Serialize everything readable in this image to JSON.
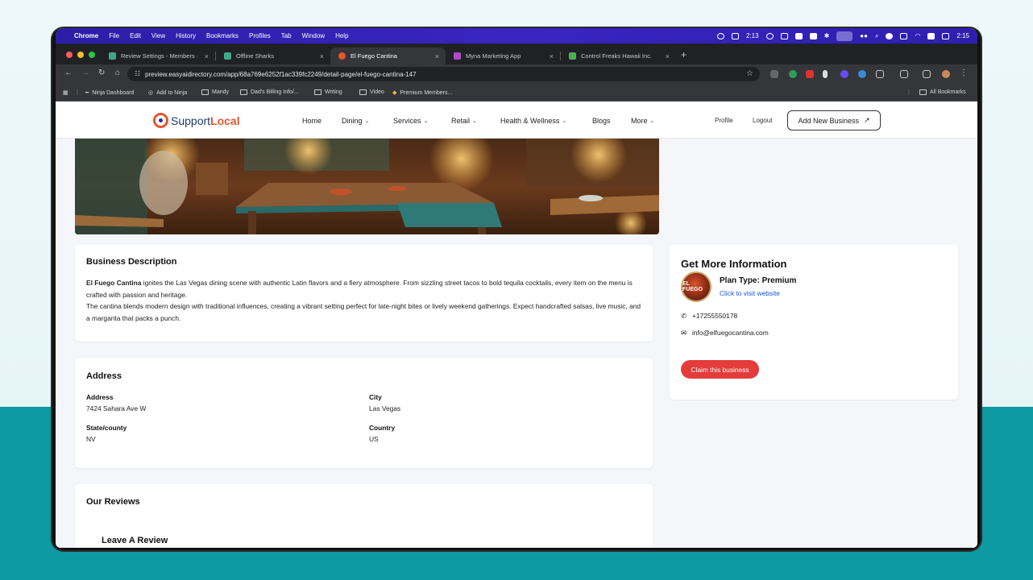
{
  "menubar": {
    "app": "Chrome",
    "items": [
      "File",
      "Edit",
      "View",
      "History",
      "Bookmarks",
      "Profiles",
      "Tab",
      "Window",
      "Help"
    ],
    "status_time_left": "2:13",
    "clock": "2:15"
  },
  "tabs": [
    {
      "label": "Review Settings - Members ·",
      "active": false
    },
    {
      "label": "Offline Sharks",
      "active": false
    },
    {
      "label": "El Fuego Cantina",
      "active": true
    },
    {
      "label": "Myna Marketing App",
      "active": false
    },
    {
      "label": "Control Freaks Hawaii Inc.",
      "active": false
    }
  ],
  "address_bar": {
    "url": "preview.easyaidirectory.com/app/68a769e6252f1ac339fc2249/detail-page/el-fuego-cantina-147"
  },
  "bookmarks": [
    {
      "label": "Ninja Dashboard"
    },
    {
      "label": "Add to Ninja"
    },
    {
      "label": "Mandy"
    },
    {
      "label": "Dad's Billing Info/..."
    },
    {
      "label": "Writing"
    },
    {
      "label": "Video"
    },
    {
      "label": "Premium Members..."
    }
  ],
  "all_bookmarks": "All Bookmarks",
  "site": {
    "logo_part1": "Support",
    "logo_part2": "Local",
    "nav": [
      {
        "label": "Home",
        "dropdown": false
      },
      {
        "label": "Dining",
        "dropdown": true
      },
      {
        "label": "Services",
        "dropdown": true
      },
      {
        "label": "Retail",
        "dropdown": true
      },
      {
        "label": "Health & Wellness",
        "dropdown": true
      },
      {
        "label": "Blogs",
        "dropdown": false
      },
      {
        "label": "More",
        "dropdown": true
      }
    ],
    "profile": "Profile",
    "logout": "Logout",
    "add_business": "Add New Business",
    "add_business_icon": "↗"
  },
  "description": {
    "heading": "Business Description",
    "business_name": "El Fuego Cantina",
    "para1_rest": " ignites the Las Vegas dining scene with authentic Latin flavors and a fiery atmosphere. From sizzling street tacos to bold tequila cocktails, every item on the menu is crafted with passion and heritage.",
    "para2": "The cantina blends modern design with traditional influences, creating a vibrant setting perfect for late-night bites or lively weekend gatherings. Expect handcrafted salsas, live music, and a margarita that packs a punch."
  },
  "address": {
    "heading": "Address",
    "address_label": "Address",
    "address_value": "7424 Sahara Ave W",
    "city_label": "City",
    "city_value": "Las Vegas",
    "state_label": "State/county",
    "state_value": "NV",
    "country_label": "Country",
    "country_value": "US"
  },
  "reviews": {
    "heading": "Our Reviews",
    "leave_review": "Leave A Review"
  },
  "info": {
    "heading": "Get More Information",
    "avatar_text": "EL FUEGO",
    "plan": "Plan Type: Premium",
    "visit": "Click to visit website",
    "phone": "+17255550178",
    "email": "info@elfuegocantina.com",
    "claim": "Claim this business"
  },
  "colors": {
    "accent_red": "#e43b3b",
    "logo_orange": "#e4572e",
    "link_blue": "#1a56db",
    "menubar": "#3a24c0",
    "teal_background": "#0d9aa0"
  }
}
